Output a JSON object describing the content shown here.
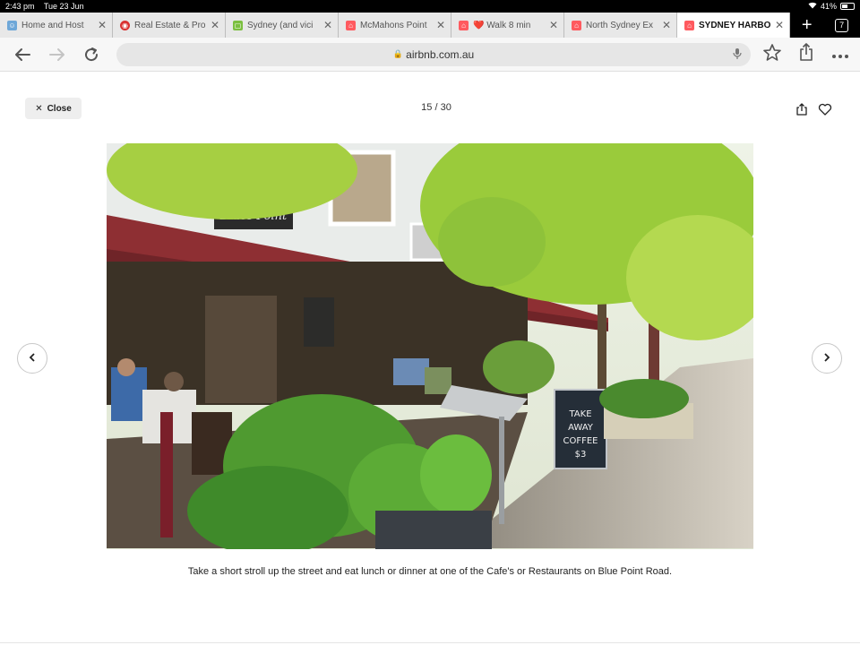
{
  "status_bar": {
    "time": "2:43 pm",
    "date": "Tue 23 Jun",
    "battery": "41%"
  },
  "tabs": [
    {
      "title": "Home and Host",
      "favicon_color": "#6ea7d8",
      "favicon": "☺"
    },
    {
      "title": "Real Estate & Pro",
      "favicon_color": "#d9302f",
      "favicon": "◉"
    },
    {
      "title": "Sydney (and vici",
      "favicon_color": "#7bbf3f",
      "favicon": "▢"
    },
    {
      "title": "McMahons Point",
      "favicon_color": "#ff5a5f",
      "favicon": "⌂"
    },
    {
      "title": "❤️ Walk 8 min",
      "favicon_color": "#ff5a5f",
      "favicon": "⌂"
    },
    {
      "title": "North Sydney Ex",
      "favicon_color": "#ff5a5f",
      "favicon": "⌂"
    },
    {
      "title": "SYDNEY HARBOU",
      "favicon_color": "#ff5a5f",
      "favicon": "⌂",
      "active": true
    }
  ],
  "tab_count": "7",
  "url": "airbnb.com.au",
  "gallery": {
    "close_label": "Close",
    "counter": "15 / 30",
    "caption": "Take a short stroll up the street and eat lunch or dinner at one of the Cafe's or Restaurants on Blue Point Road.",
    "photo_sign": "Blues Point",
    "sandwich_board": [
      "TAKE",
      "AWAY",
      "COFFEE",
      "$3"
    ]
  },
  "colors": {
    "awning": "#8e2f33",
    "foliage": "#9acb3b",
    "accent": "#ff5a5f"
  }
}
